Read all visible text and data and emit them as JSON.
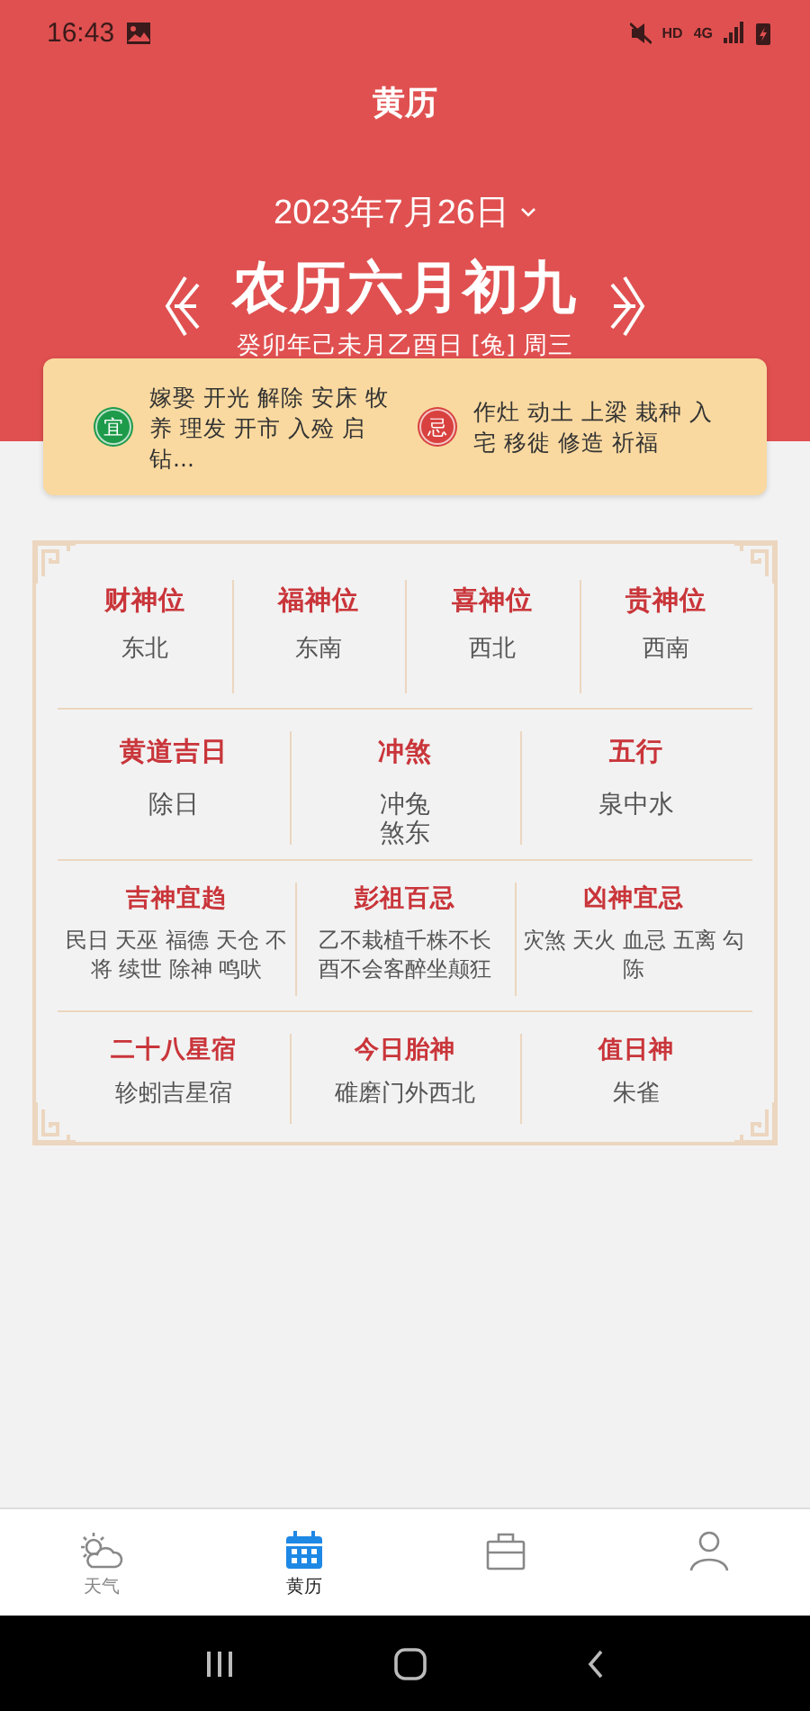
{
  "status_bar": {
    "time": "16:43",
    "hd_label": "HD",
    "network": "4G"
  },
  "header": {
    "title": "黄历",
    "date": "2023年7月26日",
    "lunar_date": "农历六月初九",
    "ganzhi": "癸卯年己未月乙酉日 [兔] 周三"
  },
  "almanac": [
    {
      "kind": "good",
      "mark": "宜",
      "text": "嫁娶 开光 解除 安床 牧养 理发 开市 入殓 启钻..."
    },
    {
      "kind": "bad",
      "mark": "忌",
      "text": "作灶 动土 上梁 栽种 入宅 移徙 修造 祈福"
    }
  ],
  "details": [
    [
      {
        "title": "财神位",
        "value": "东北"
      },
      {
        "title": "福神位",
        "value": "东南"
      },
      {
        "title": "喜神位",
        "value": "西北"
      },
      {
        "title": "贵神位",
        "value": "西南"
      }
    ],
    [
      {
        "title": "黄道吉日",
        "value": "除日"
      },
      {
        "title": "冲煞",
        "value": "冲兔煞东"
      },
      {
        "title": "五行",
        "value": "泉中水"
      }
    ],
    [
      {
        "title": "吉神宜趋",
        "value": "民日 天巫 福德 天仓 不将 续世 除神 鸣吠"
      },
      {
        "title": "彭祖百忌",
        "value": "乙不栽植千株不长酉不会客醉坐颠狂"
      },
      {
        "title": "凶神宜忌",
        "value": "灾煞 天火 血忌 五离 勾陈"
      }
    ],
    [
      {
        "title": "二十八星宿",
        "value": "轸蚓吉星宿"
      },
      {
        "title": "今日胎神",
        "value": "碓磨门外西北"
      },
      {
        "title": "值日神",
        "value": "朱雀"
      }
    ]
  ],
  "bottom_nav": [
    {
      "kind": "weather",
      "label": "天气",
      "selected": false
    },
    {
      "kind": "calendar",
      "label": "黄历",
      "selected": true
    },
    {
      "kind": "briefcase",
      "selected": false
    },
    {
      "kind": "person",
      "selected": false
    }
  ]
}
